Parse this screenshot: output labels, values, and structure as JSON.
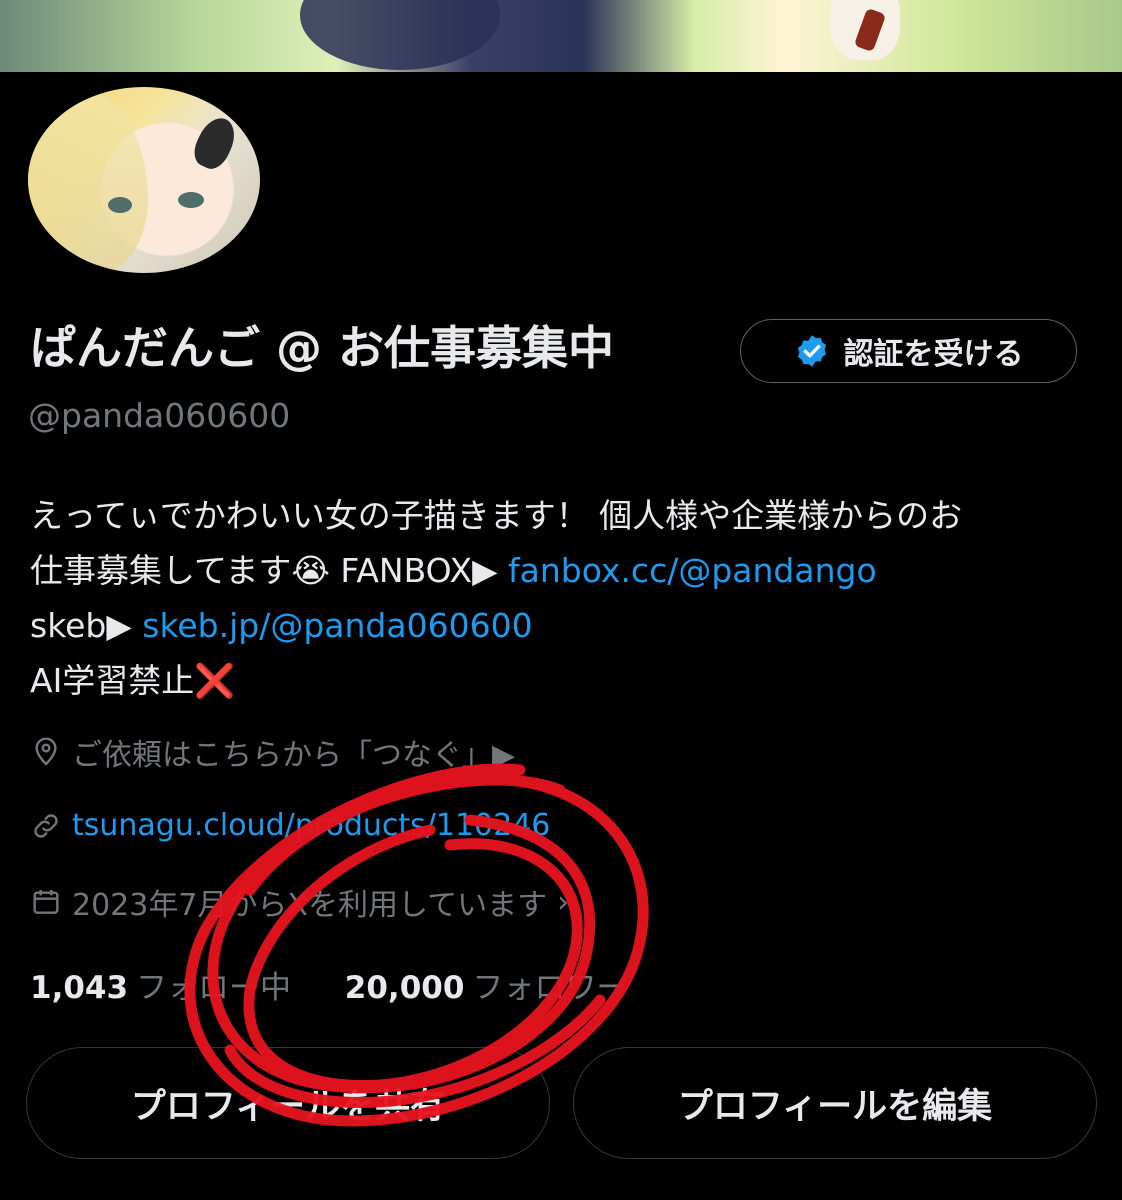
{
  "profile": {
    "name": "ぱんだんご @ お仕事募集中",
    "handle": "@panda060600",
    "verify_label": "認証を受ける",
    "bio": {
      "line1": "えってぃでかわいい女の子描きます！ 個人様や企業様からのお",
      "line2_text": "仕事募集してます😭 FANBOX▶ ",
      "line2_link": "fanbox.cc/@pandango",
      "line3_text": "skeb▶ ",
      "line3_link": "skeb.jp/@panda060600",
      "line4_text": "AI学習禁止",
      "line4_mark": "❌"
    },
    "location": "ご依頼はこちらから「つなぐ」▶",
    "website": "tsunagu.cloud/products/110246",
    "joined": "2023年7月からXを利用しています",
    "following_count": "1,043",
    "following_label": "フォロー中",
    "followers_count": "20,000",
    "followers_label": "フォロワー"
  },
  "buttons": {
    "share_label": "プロフィールを共有",
    "edit_label": "プロフィールを編集"
  },
  "colors": {
    "accent": "#1d9bf0",
    "muted": "#71767b",
    "text": "#e7e9ea",
    "annotation": "#e8131f"
  },
  "icons": [
    "verified-badge-icon",
    "location-pin-icon",
    "link-icon",
    "calendar-icon"
  ]
}
